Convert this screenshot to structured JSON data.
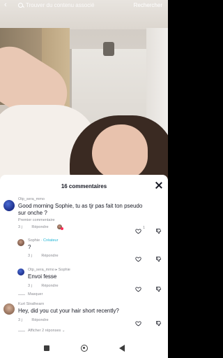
{
  "search": {
    "placeholder": "Trouver du contenu associé",
    "button_label": "Rechercher"
  },
  "sheet": {
    "title": "16 commentaires"
  },
  "comments": [
    {
      "username": "Otp_sera_mmo",
      "text": "Good morning Sophie, tu as tjr pas fait ton pseudo sur onche ?",
      "pin_label": "Premier commentaire",
      "age": "3 j",
      "reply_label": "Répondre",
      "likes": "1"
    },
    {
      "username": "Sophie",
      "badge": "· Créateur",
      "text": "?",
      "age": "3 j",
      "reply_label": "Répondre"
    },
    {
      "username": "Otp_sera_mmo",
      "reply_to": "▸ Sophie",
      "text": "Envoi fesse",
      "age": "3 j",
      "reply_label": "Répondre",
      "hide_label": "Masquer"
    },
    {
      "username": "Kurt Strathearn",
      "text": "Hey, did you cut your hair short recently?",
      "age": "3 j",
      "reply_label": "Répondre",
      "more_replies_label": "Afficher 2 réponses ⌄"
    }
  ],
  "icons": {
    "back": "chevron-left-icon",
    "search": "search-icon",
    "close": "close-icon",
    "heart": "heart-icon",
    "dislike": "dislike-icon"
  },
  "colors": {
    "creator_badge": "#20b5d5",
    "text_primary": "#161823",
    "text_secondary": "#8a8b91",
    "like_accent": "#fe2c55"
  }
}
